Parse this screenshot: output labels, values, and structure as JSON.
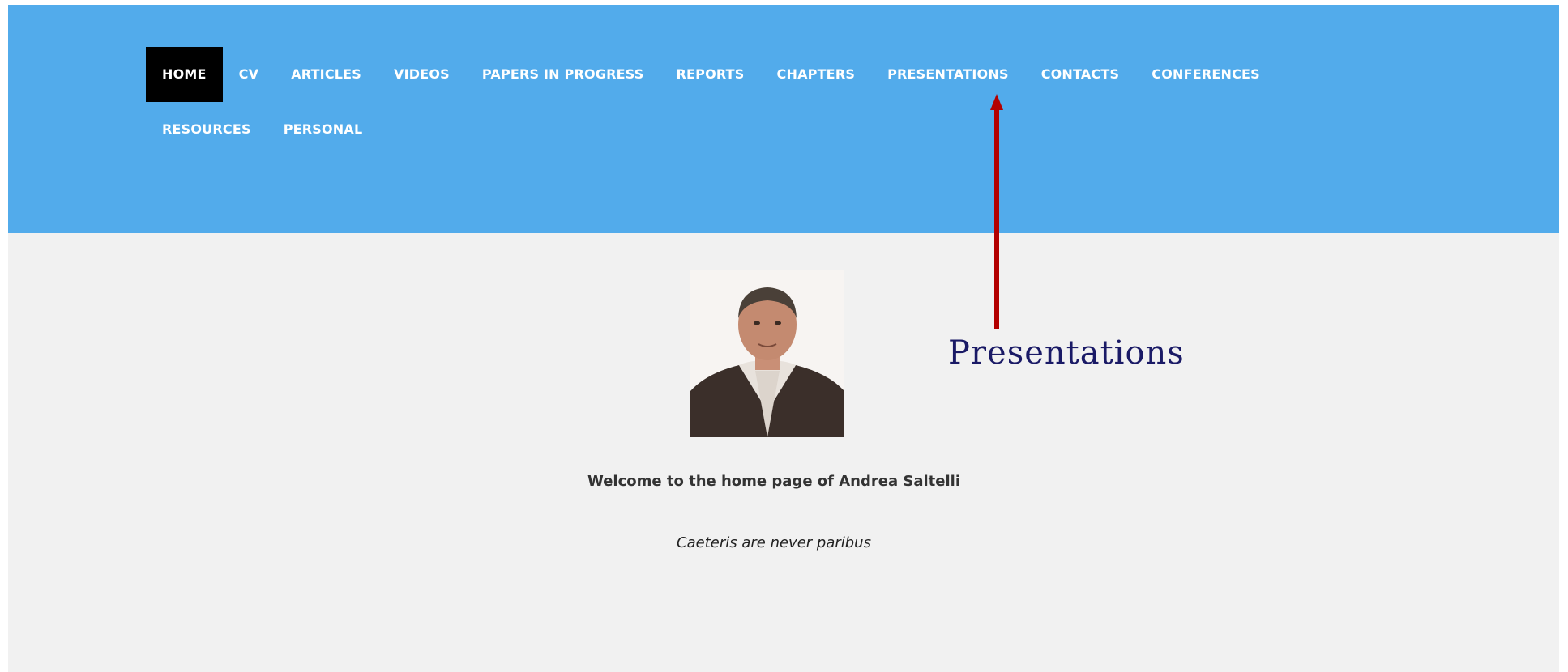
{
  "nav": {
    "items": [
      {
        "label": "HOME",
        "active": true
      },
      {
        "label": "CV"
      },
      {
        "label": "ARTICLES"
      },
      {
        "label": "VIDEOS"
      },
      {
        "label": "PAPERS IN PROGRESS"
      },
      {
        "label": "REPORTS"
      },
      {
        "label": "CHAPTERS"
      },
      {
        "label": "PRESENTATIONS"
      },
      {
        "label": "CONTACTS"
      },
      {
        "label": "CONFERENCES"
      },
      {
        "label": "RESOURCES"
      },
      {
        "label": "PERSONAL"
      }
    ]
  },
  "main": {
    "welcome": "Welcome to the home page of Andrea Saltelli",
    "motto": "Caeteris are never paribus"
  },
  "annotation": {
    "label": "Presentations",
    "arrow_color": "#b30000",
    "text_color": "#1a1a66"
  },
  "colors": {
    "header_bg": "#52abeb",
    "page_bg": "#f1f1f1",
    "active_nav_bg": "#000000"
  }
}
